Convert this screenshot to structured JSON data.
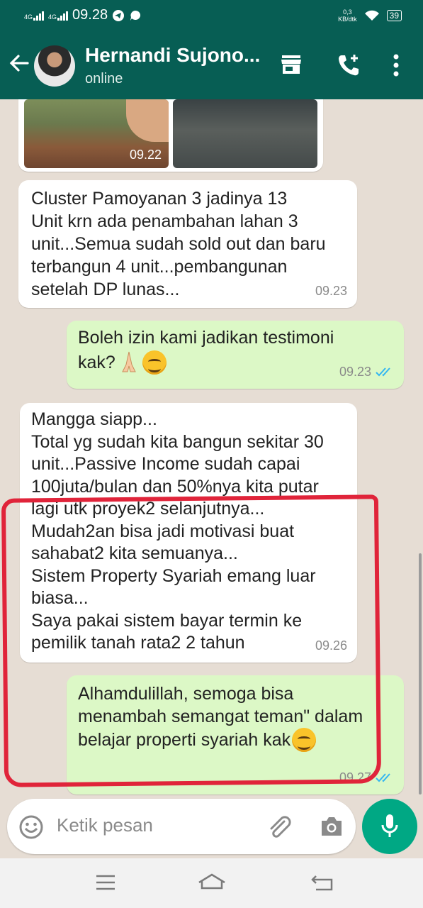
{
  "status_bar": {
    "signal_1": "4G",
    "signal_2": "4G",
    "time": "09.28",
    "net_speed_value": "0,3",
    "net_speed_unit": "KB/dtk",
    "battery": "39"
  },
  "header": {
    "contact_name": "Hernandi Sujono...",
    "status": "online",
    "icons": [
      "back-arrow-icon",
      "shop-icon",
      "add-call-icon",
      "more-vert-icon"
    ]
  },
  "messages": [
    {
      "type": "image",
      "direction": "incoming",
      "time": "09.22"
    },
    {
      "type": "text",
      "direction": "incoming",
      "text": "Cluster Pamoyanan 3 jadinya 13\nUnit krn ada penambahan lahan 3\nunit...Semua sudah sold out dan baru\nterbangun 4 unit...pembangunan\nsetelah DP lunas...",
      "time": "09.23"
    },
    {
      "type": "text",
      "direction": "outgoing",
      "text_line1": "Boleh izin kami jadikan testimoni",
      "text_line2": "kak?",
      "time": "09.23",
      "ticks": "read"
    },
    {
      "type": "text",
      "direction": "incoming",
      "text": "Mangga siapp...\nTotal yg sudah kita bangun sekitar 30\nunit...Passive Income sudah capai\n100juta/bulan dan 50%nya kita putar\nlagi utk proyek2 selanjutnya...\nMudah2an bisa jadi motivasi buat\nsahabat2 kita semuanya...\nSistem Property Syariah emang luar\nbiasa...\nSaya pakai sistem bayar termin ke\npemilik tanah rata2 2 tahun",
      "time": "09.26"
    },
    {
      "type": "text",
      "direction": "outgoing",
      "text_line1": "Alhamdulillah, semoga bisa",
      "text_line2": "menambah semangat teman\" dalam",
      "text_line3": "belajar properti syariah kak",
      "time": "09.27",
      "ticks": "read"
    }
  ],
  "input": {
    "placeholder": "Ketik pesan"
  },
  "colors": {
    "header": "#075e54",
    "outgoing_bubble": "#dcf8c6",
    "mic": "#00a884",
    "read_ticks": "#34b7f1",
    "annotation": "#e0243a"
  }
}
